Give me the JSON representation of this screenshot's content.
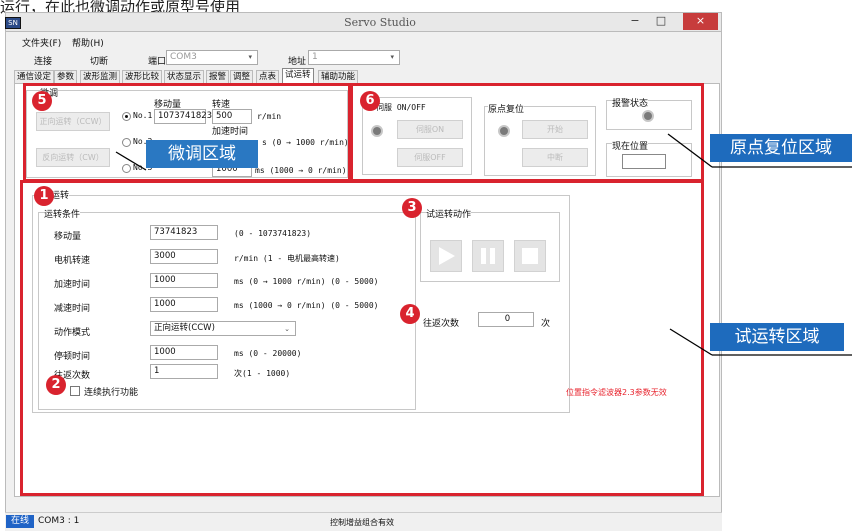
{
  "caption": {
    "text": "运行，在此也微调动作或原型号使用"
  },
  "app": {
    "icon_text": "SN",
    "title": "Servo Studio"
  },
  "window_buttons": {
    "minimize": "−",
    "maximize": "□",
    "close": "×"
  },
  "menu": {
    "file": "文件夹(F)",
    "help": "帮助(H)"
  },
  "toolbar": {
    "connect": "连接",
    "disconnect": "切断",
    "port_label": "端口",
    "port_value": "COM3",
    "addr_label": "地址",
    "addr_value": "1"
  },
  "tabs": [
    "通信设定",
    "参数",
    "波形监测",
    "波形比较",
    "状态显示",
    "报警",
    "调整",
    "点表",
    "试运转",
    "辅助功能"
  ],
  "tabs_active_index": 8,
  "jog": {
    "group_title": "微调",
    "btn_ccw": "正向运转（CCW）",
    "btn_cw": "反向运转（CW）",
    "radios": [
      "No.1",
      "No.2",
      "No.3"
    ],
    "move_label": "移动量",
    "move_value": "1073741823",
    "speed_label": "转速",
    "speed_value": "500",
    "speed_unit": "r/min",
    "accel_label": "加速时间",
    "accel_range": "s (0 → 1000 r/min)",
    "decel_value": "1000",
    "decel_range": "ms (1000 → 0 r/min)"
  },
  "origin": {
    "servo_title": "伺服 ON/OFF",
    "servo_on": "伺服ON",
    "servo_off": "伺服OFF",
    "home_title": "原点复位",
    "home_start": "开始",
    "home_stop": "中断",
    "alarm_label": "报警状态",
    "pos_label": "现在位置"
  },
  "trial": {
    "group_title": "试运转",
    "cond_title": "运转条件",
    "rows": [
      {
        "label": "移动量",
        "value": "73741823",
        "hint": "(0 - 1073741823)"
      },
      {
        "label": "电机转速",
        "value": "3000",
        "hint": "r/min (1 - 电机最高转速)"
      },
      {
        "label": "加速时间",
        "value": "1000",
        "hint": "ms (0 → 1000 r/min) (0 - 5000)"
      },
      {
        "label": "减速时间",
        "value": "1000",
        "hint": "ms (1000 → 0 r/min) (0 - 5000)"
      },
      {
        "label": "动作模式",
        "value": "正向运转(CCW)",
        "hint": ""
      },
      {
        "label": "停顿时间",
        "value": "1000",
        "hint": "ms (0 - 20000)"
      },
      {
        "label": "往返次数",
        "value": "1",
        "hint": "次(1 - 1000)"
      }
    ],
    "continuous_label": "连续执行功能",
    "action_title": "试运转动作",
    "repeat_label": "往返次数",
    "repeat_value": "0",
    "repeat_unit": "次",
    "warning": "位置指令滤波器2.3参数无效"
  },
  "annotations": {
    "jog_region": "微调区域",
    "origin_region": "原点复位区域",
    "trial_region": "试运转区域",
    "markers": [
      "1",
      "2",
      "3",
      "4",
      "5",
      "6"
    ]
  },
  "status": {
    "badge": "在线",
    "port": "COM3 : 1",
    "message": "控制增益组合有效"
  },
  "colors": {
    "accent_red": "#d9232e",
    "label_blue": "#2a78c2",
    "warning_red": "#e8242e",
    "close_red": "#c73c3c"
  }
}
